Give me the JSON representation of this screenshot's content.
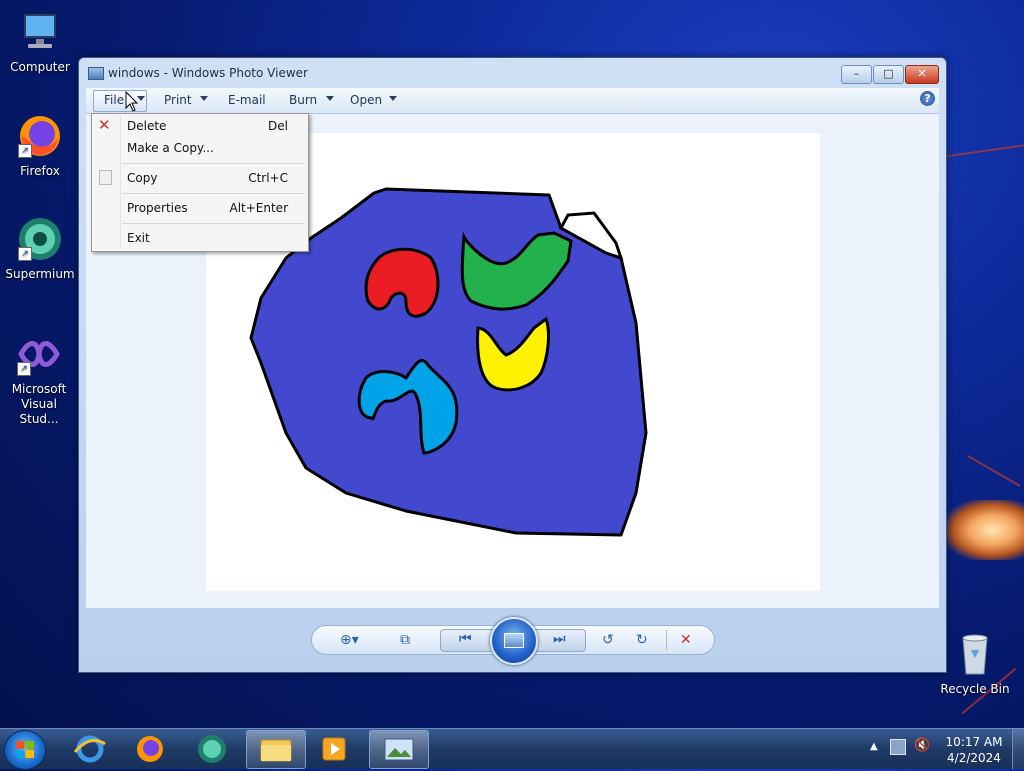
{
  "desktop": {
    "icons": [
      {
        "label": "Computer"
      },
      {
        "label": "Firefox"
      },
      {
        "label": "Supermium"
      },
      {
        "label": "Microsoft Visual Stud..."
      },
      {
        "label": "Recycle Bin"
      }
    ]
  },
  "window": {
    "title": "windows - Windows Photo Viewer",
    "controls": {
      "minimize": "–",
      "maximize": "□",
      "close": "✕"
    }
  },
  "menubar": {
    "file": "File",
    "print": "Print",
    "email": "E-mail",
    "burn": "Burn",
    "open": "Open",
    "help": "?"
  },
  "file_menu": {
    "items": [
      {
        "label": "Delete",
        "shortcut": "Del"
      },
      {
        "label": "Make a Copy...",
        "shortcut": ""
      },
      {
        "label": "Copy",
        "shortcut": "Ctrl+C"
      },
      {
        "label": "Properties",
        "shortcut": "Alt+Enter"
      },
      {
        "label": "Exit",
        "shortcut": ""
      }
    ]
  },
  "taskbar": {
    "time": "10:17 AM",
    "date": "4/2/2024"
  },
  "colors": {
    "blob": "#4349cf",
    "red": "#ec1c24",
    "green": "#22b14c",
    "yellow": "#fff200",
    "cyan": "#00a2e8"
  }
}
